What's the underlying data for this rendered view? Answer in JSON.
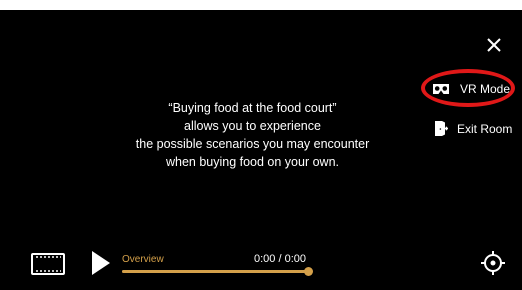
{
  "colors": {
    "background": "#000000",
    "accent_gold": "#d4a04a",
    "highlight_red": "#e01818",
    "text": "#ffffff"
  },
  "top_right": {
    "close_icon": "close-icon",
    "menu": [
      {
        "icon": "vr-headset-icon",
        "label": "VR Mode",
        "highlighted": true
      },
      {
        "icon": "exit-door-icon",
        "label": "Exit Room",
        "highlighted": false
      }
    ]
  },
  "description": {
    "lines": [
      "“Buying food at the food court”",
      "allows you to experience",
      "the possible scenarios you may encounter",
      "when buying food on your own."
    ]
  },
  "player": {
    "chapters_icon": "film-strip-icon",
    "play_icon": "play-icon",
    "chapter_title": "Overview",
    "time": "0:00 / 0:00",
    "progress_fraction": 1.0,
    "recenter_icon": "recenter-target-icon"
  }
}
